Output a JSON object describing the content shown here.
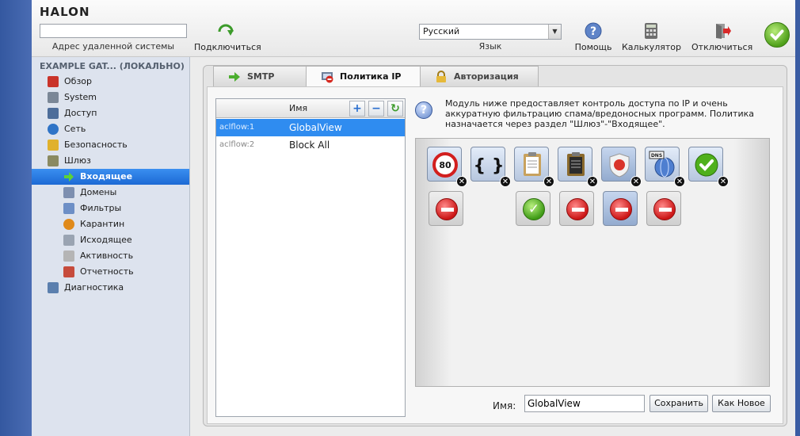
{
  "brand": "HALON",
  "toolbar": {
    "remote_value": "",
    "remote_label": "Адрес удаленной системы",
    "connect_label": "Подключиться",
    "language_value": "Русский",
    "language_label": "Язык",
    "help_label": "Помощь",
    "calc_label": "Калькулятор",
    "disconnect_label": "Отключиться"
  },
  "sidebar": {
    "title": "EXAMPLE GAT... (ЛОКАЛЬНО)",
    "items": [
      {
        "label": "Обзор",
        "icon": "home-icon",
        "color": "#c9332a"
      },
      {
        "label": "System",
        "icon": "tools-icon",
        "color": "#7b8797"
      },
      {
        "label": "Доступ",
        "icon": "monitor-icon",
        "color": "#4d6d9a"
      },
      {
        "label": "Сеть",
        "icon": "globe-icon",
        "color": "#2f74c7"
      },
      {
        "label": "Безопасность",
        "icon": "lock-icon",
        "color": "#e0b12c"
      },
      {
        "label": "Шлюз",
        "icon": "gateway-icon",
        "color": "#8a8a62"
      },
      {
        "label": "Входящее",
        "icon": "arrow-right-icon",
        "color": "#4cae2f"
      },
      {
        "label": "Домены",
        "icon": "domains-icon",
        "color": "#7d8fb0"
      },
      {
        "label": "Фильтры",
        "icon": "filter-icon",
        "color": "#6d8fc6"
      },
      {
        "label": "Карантин",
        "icon": "biohazard-icon",
        "color": "#e08a1a"
      },
      {
        "label": "Исходящее",
        "icon": "outbox-icon",
        "color": "#9aa4b2"
      },
      {
        "label": "Активность",
        "icon": "activity-icon",
        "color": "#b5b5b5"
      },
      {
        "label": "Отчетность",
        "icon": "report-icon",
        "color": "#c64b3c"
      },
      {
        "label": "Диагностика",
        "icon": "diagnostics-icon",
        "color": "#5b7fae"
      }
    ]
  },
  "tabs": [
    {
      "label": "SMTP",
      "icon": "arrow-right-icon"
    },
    {
      "label": "Политика IP",
      "icon": "ip-policy-icon"
    },
    {
      "label": "Авторизация",
      "icon": "lock-icon"
    }
  ],
  "list": {
    "header": "Имя",
    "rows": [
      {
        "id": "aclflow:1",
        "name": "GlobalView"
      },
      {
        "id": "aclflow:2",
        "name": "Block All"
      }
    ]
  },
  "info_text": "Модуль ниже предоставляет контроль доступа по IP и очень аккуратную фильтрацию спама/вредоносных программ. Политика назначается через раздел \"Шлюз\"-\"Входящее\".",
  "flow": {
    "nodes": [
      {
        "icon": "speed-limit-icon",
        "text": "80"
      },
      {
        "icon": "braces-icon",
        "text": "{ }"
      },
      {
        "icon": "clipboard-icon",
        "text": ""
      },
      {
        "icon": "clipboard-dark-icon",
        "text": ""
      },
      {
        "icon": "shield-icon",
        "text": ""
      },
      {
        "icon": "dns-globe-icon",
        "text": "DNS"
      },
      {
        "icon": "accept-icon",
        "text": ""
      }
    ]
  },
  "form": {
    "name_label": "Имя:",
    "name_value": "GlobalView",
    "save_label": "Сохранить",
    "save_as_new_label": "Как Новое"
  }
}
